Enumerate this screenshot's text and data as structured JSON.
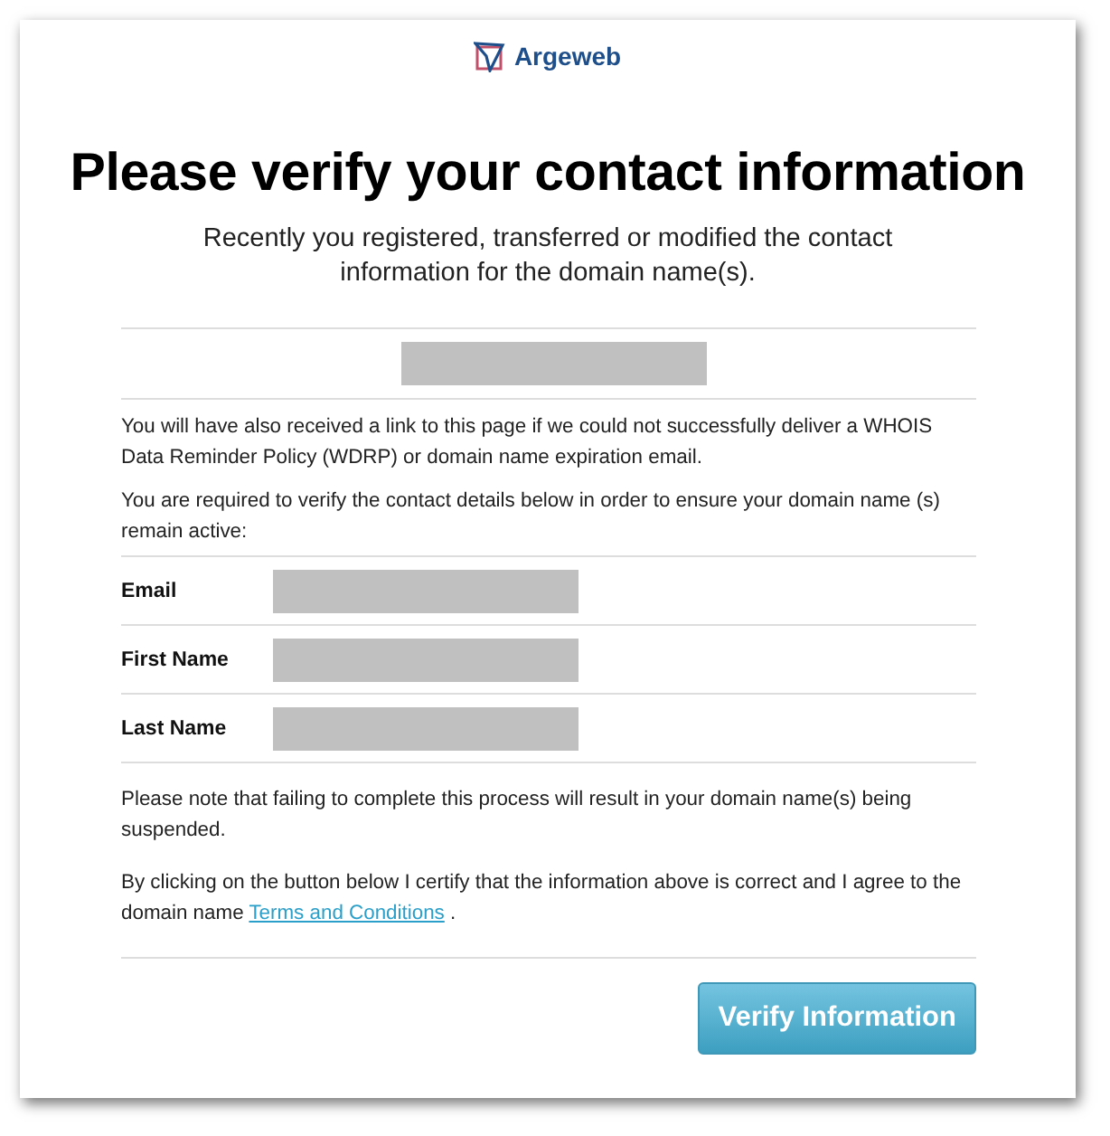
{
  "logo": {
    "name": "Argeweb"
  },
  "heading": "Please verify your contact information",
  "subheading": "Recently you registered, transferred or modified the contact information for the domain name(s).",
  "domain": {
    "redacted": true
  },
  "intro": [
    "You will have also received a link to this page if we could not successfully deliver a WHOIS Data Reminder Policy (WDRP) or domain name expiration email.",
    "You are required to verify the contact details below in order to ensure your domain name (s) remain active:"
  ],
  "fields": [
    {
      "label": "Email",
      "redacted": true
    },
    {
      "label": "First Name",
      "redacted": true
    },
    {
      "label": "Last Name",
      "redacted": true
    }
  ],
  "notice": "Please note that failing to complete this process will result in your domain name(s) being suspended.",
  "agreement": {
    "text_before": "By clicking on the button below I certify that the information above is correct and I agree to the domain name",
    "link": "Terms and Conditions",
    "text_after": "."
  },
  "button": "Verify Information"
}
